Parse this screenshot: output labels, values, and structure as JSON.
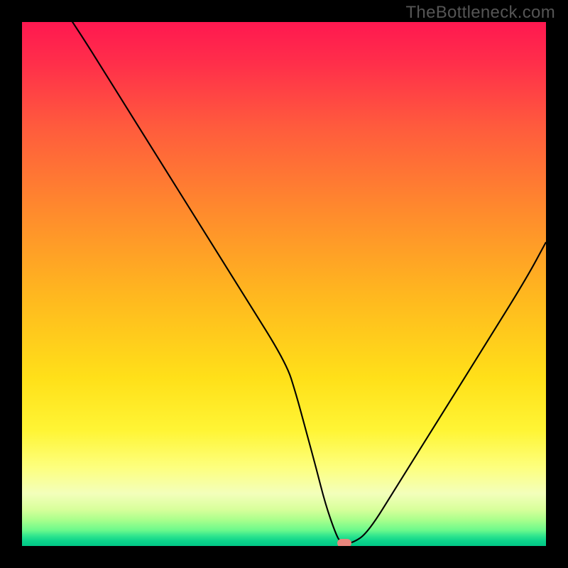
{
  "watermark": "TheBottleneck.com",
  "chart_data": {
    "type": "line",
    "title": "",
    "xlabel": "",
    "ylabel": "",
    "xlim": [
      0,
      100
    ],
    "ylim": [
      0,
      100
    ],
    "x": [
      0,
      9.76,
      17.89,
      26.02,
      34.15,
      42.28,
      50.41,
      52.3,
      54.2,
      56.1,
      57.9,
      59.8,
      60.84,
      63,
      66,
      71.82,
      79.95,
      88.08,
      96.21,
      100
    ],
    "values": [
      114,
      100,
      86.99,
      73.98,
      60.98,
      47.97,
      34.96,
      29,
      22,
      15,
      8,
      2.5,
      0.5,
      0.5,
      2.5,
      11.87,
      24.87,
      37.88,
      50.98,
      58
    ],
    "marker": {
      "x": 61.5,
      "y": 0.5,
      "color": "#e8867d"
    },
    "gradient_stops": [
      {
        "pos": 0,
        "color": "#ff1850"
      },
      {
        "pos": 8,
        "color": "#ff2f4a"
      },
      {
        "pos": 20,
        "color": "#ff5b3d"
      },
      {
        "pos": 36,
        "color": "#ff8a2d"
      },
      {
        "pos": 52,
        "color": "#ffb71f"
      },
      {
        "pos": 68,
        "color": "#ffe019"
      },
      {
        "pos": 78,
        "color": "#fff535"
      },
      {
        "pos": 85,
        "color": "#fdff7e"
      },
      {
        "pos": 90,
        "color": "#f3ffbb"
      },
      {
        "pos": 93,
        "color": "#d8ff9b"
      },
      {
        "pos": 95,
        "color": "#aaff8c"
      },
      {
        "pos": 97,
        "color": "#6bf98c"
      },
      {
        "pos": 98,
        "color": "#33e68e"
      },
      {
        "pos": 99,
        "color": "#0dd48b"
      },
      {
        "pos": 100,
        "color": "#01c786"
      }
    ]
  }
}
